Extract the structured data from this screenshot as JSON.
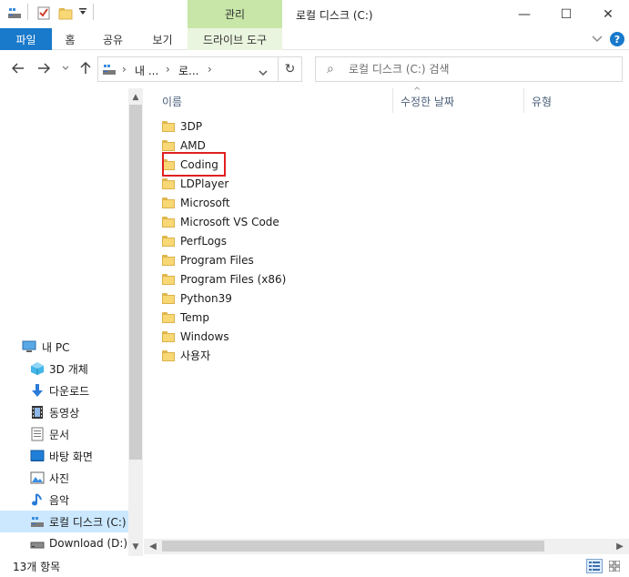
{
  "window": {
    "title": "로컬 디스크 (C:)",
    "context_tab_header": "관리",
    "controls": {
      "minimize": "—",
      "maximize": "☐",
      "close": "✕"
    }
  },
  "quick_access": {
    "icons": [
      "drive-icon",
      "properties-check-icon",
      "new-folder-icon",
      "customize-dropdown-icon"
    ]
  },
  "ribbon": {
    "tabs": [
      {
        "label": "파일",
        "kind": "file"
      },
      {
        "label": "홈",
        "kind": "normal"
      },
      {
        "label": "공유",
        "kind": "normal"
      },
      {
        "label": "보기",
        "kind": "normal"
      },
      {
        "label": "드라이브 도구",
        "kind": "context"
      }
    ],
    "expand_icon": "chevron-down-icon",
    "help_label": "?"
  },
  "address": {
    "crumbs": [
      "내 ...",
      "로..."
    ],
    "placeholder_search": "로컬 디스크 (C:) 검색"
  },
  "nav_pane": {
    "items": [
      {
        "label": "내 PC",
        "icon": "pc-icon"
      },
      {
        "label": "3D 개체",
        "icon": "3d-objects-icon"
      },
      {
        "label": "다운로드",
        "icon": "download-icon"
      },
      {
        "label": "동영상",
        "icon": "video-icon"
      },
      {
        "label": "문서",
        "icon": "document-icon"
      },
      {
        "label": "바탕 화면",
        "icon": "desktop-icon"
      },
      {
        "label": "사진",
        "icon": "pictures-icon"
      },
      {
        "label": "음악",
        "icon": "music-icon"
      },
      {
        "label": "로컬 디스크 (C:)",
        "icon": "drive-c-icon",
        "selected": true
      },
      {
        "label": "Download (D:)",
        "icon": "drive-d-icon"
      }
    ]
  },
  "columns": {
    "name": "이름",
    "modified": "수정한 날짜",
    "type": "유형"
  },
  "files": [
    {
      "name": "3DP"
    },
    {
      "name": "AMD"
    },
    {
      "name": "Coding",
      "highlighted": true
    },
    {
      "name": "LDPlayer"
    },
    {
      "name": "Microsoft"
    },
    {
      "name": "Microsoft VS Code"
    },
    {
      "name": "PerfLogs"
    },
    {
      "name": "Program Files"
    },
    {
      "name": "Program Files (x86)"
    },
    {
      "name": "Python39"
    },
    {
      "name": "Temp"
    },
    {
      "name": "Windows"
    },
    {
      "name": "사용자"
    }
  ],
  "status": {
    "item_count": "13개 항목"
  },
  "colors": {
    "file_tab": "#1979ca",
    "context_tab": "#c7e6a8",
    "selection": "#cce8ff",
    "highlight_box": "#e02020",
    "folder": "#f8d775"
  }
}
